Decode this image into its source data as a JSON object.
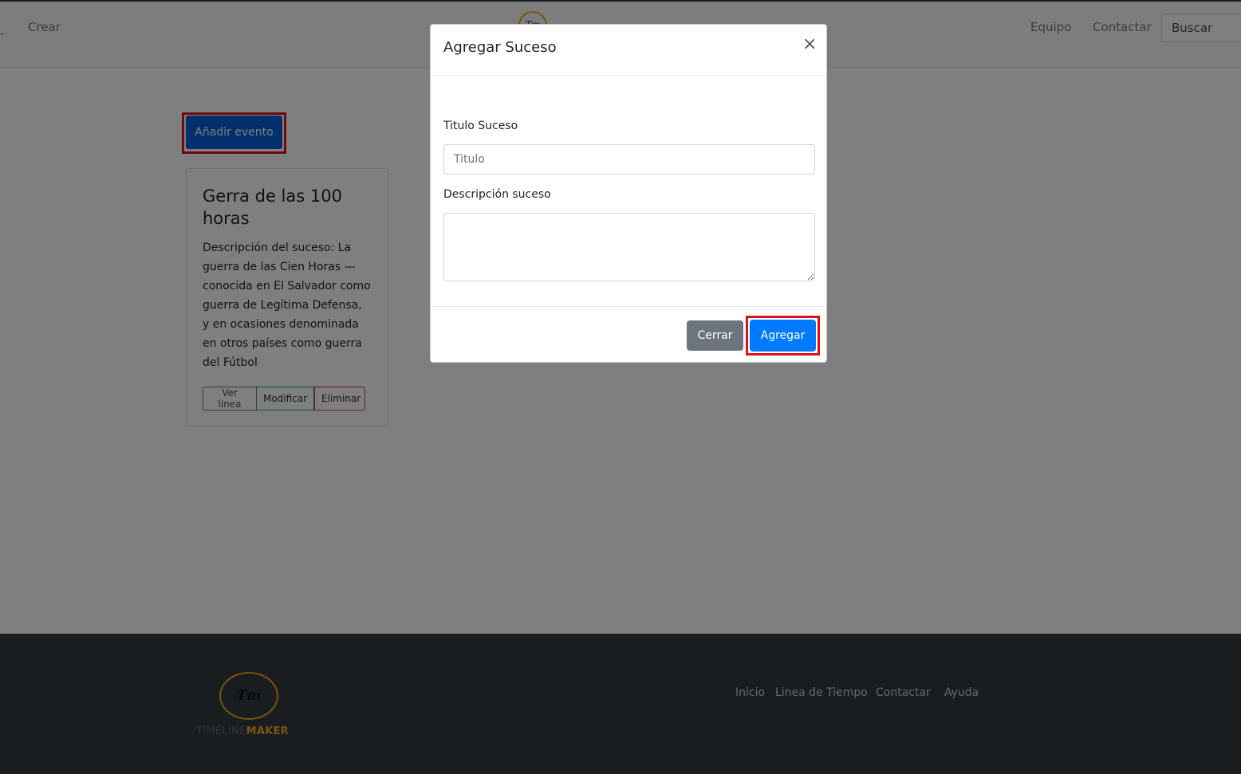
{
  "navbar": {
    "dash": "-",
    "crear": "Crear",
    "logo_text": "Tm",
    "equipo": "Equipo",
    "contactar": "Contactar",
    "search_placeholder": "Buscar"
  },
  "main": {
    "add_event_label": "Añadir evento",
    "card": {
      "title": "Gerra de las 100 horas",
      "description": "Descripción del suceso: La guerra de las Cien Horas —conocida en El Salvador como guerra de Legítima Defensa, y en ocasiones denominada en otros países como guerra del Fútbol",
      "buttons": {
        "ver": "Ver linea",
        "modificar": "Modificar",
        "eliminar": "Eliminar"
      }
    }
  },
  "footer": {
    "logo_mark": "Tm",
    "brand_part1": "TIMELINE",
    "brand_part2": "MAKER",
    "links": [
      "Inicio",
      "Linea de Tiempo",
      "Contactar",
      "Ayuda"
    ]
  },
  "modal": {
    "title": "Agregar Suceso",
    "close_symbol": "×",
    "title_label": "Titulo Suceso",
    "title_placeholder": "Titulo",
    "desc_label": "Descripción suceso",
    "desc_value": "",
    "cancel_label": "Cerrar",
    "submit_label": "Agregar"
  },
  "colors": {
    "primary": "#007bff",
    "highlight": "#e0101a",
    "brand_gold": "#f0a81a",
    "footer_bg": "#343a40"
  }
}
